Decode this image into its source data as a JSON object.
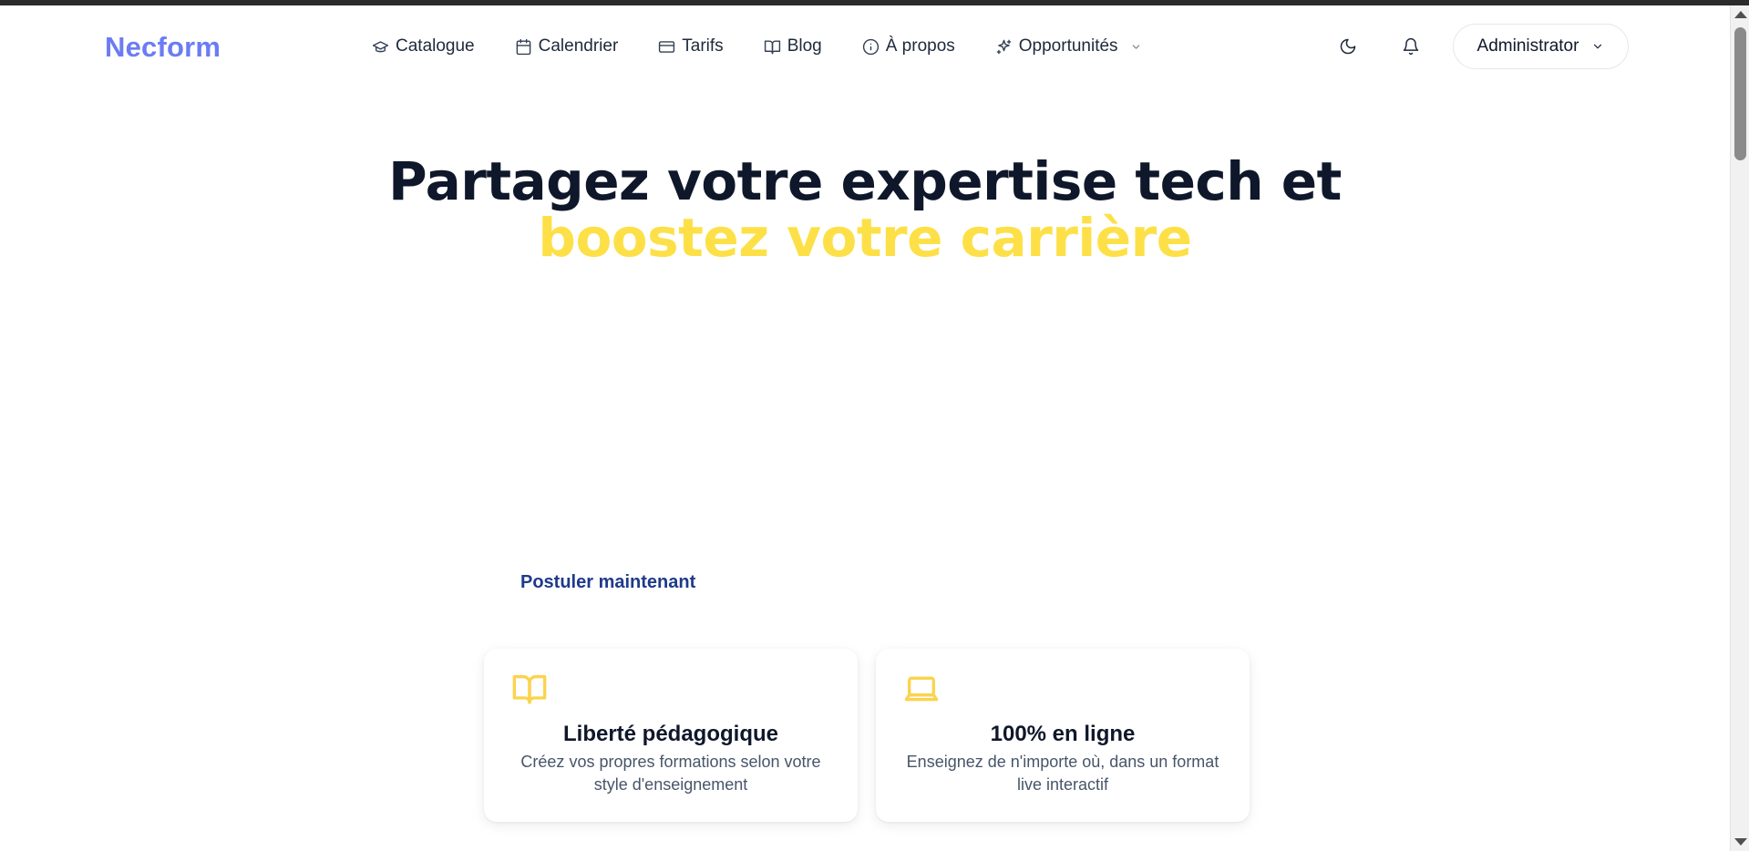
{
  "header": {
    "logo": "Necform",
    "nav": [
      {
        "label": "Catalogue",
        "icon": "graduation-cap-icon"
      },
      {
        "label": "Calendrier",
        "icon": "calendar-icon"
      },
      {
        "label": "Tarifs",
        "icon": "credit-card-icon"
      },
      {
        "label": "Blog",
        "icon": "book-open-icon"
      },
      {
        "label": "À propos",
        "icon": "info-icon"
      },
      {
        "label": "Opportunités",
        "icon": "sparkles-icon",
        "dropdown": true
      }
    ],
    "theme_icon": "moon-icon",
    "notifications_icon": "bell-icon",
    "user_label": "Administrator"
  },
  "hero": {
    "title_line1": "Partagez votre expertise tech et",
    "title_line2": "boostez votre carrière"
  },
  "cta": {
    "apply_label": "Postuler maintenant"
  },
  "features": [
    {
      "icon": "book-open-icon",
      "title": "Liberté pédagogique",
      "text": "Créez vos propres formations selon votre style d'enseignement"
    },
    {
      "icon": "laptop-icon",
      "title": "100% en ligne",
      "text": "Enseignez de n'importe où, dans un format live interactif"
    }
  ],
  "colors": {
    "brand": "#6b7cf3",
    "accent": "#fde047",
    "heading": "#0f172a",
    "link": "#1e3a8a"
  }
}
